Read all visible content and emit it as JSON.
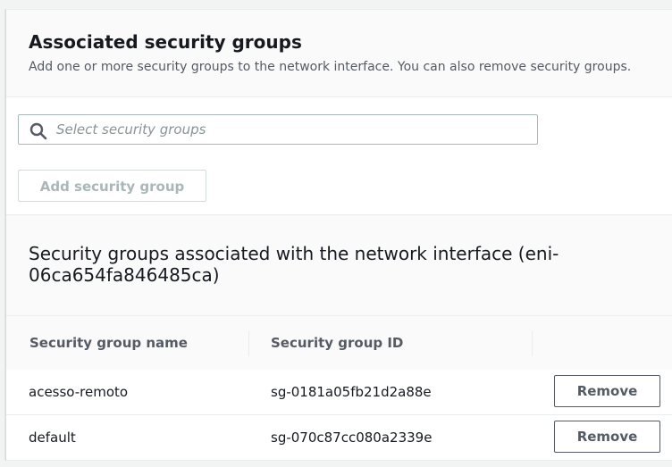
{
  "panel": {
    "title": "Associated security groups",
    "description": "Add one or more security groups to the network interface. You can also remove security groups."
  },
  "search": {
    "placeholder": "Select security groups",
    "icon": "search-icon"
  },
  "add_button": {
    "label": "Add security group",
    "disabled": true
  },
  "associated": {
    "title": "Security groups associated with the network interface (eni-06ca654fa846485ca)",
    "columns": [
      "Security group name",
      "Security group ID",
      ""
    ],
    "rows": [
      {
        "name": "acesso-remoto",
        "id": "sg-0181a05fb21d2a88e",
        "action": "Remove"
      },
      {
        "name": "default",
        "id": "sg-070c87cc080a2339e",
        "action": "Remove"
      }
    ]
  },
  "colors": {
    "accent_text": "#16191f",
    "secondary_text": "#545b64",
    "disabled_text": "#aab7b8",
    "border": "#aab7b8",
    "header_bg": "#fafafa"
  }
}
